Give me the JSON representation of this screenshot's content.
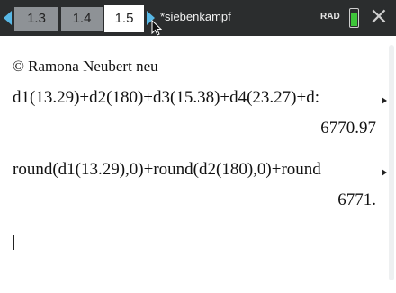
{
  "tabs": [
    {
      "label": "1.3",
      "active": false
    },
    {
      "label": "1.4",
      "active": false
    },
    {
      "label": "1.5",
      "active": true
    }
  ],
  "document_title": "*siebenkampf",
  "angle_mode": "RAD",
  "battery_level": 0.75,
  "colors": {
    "tab_bar": "#2b2d2e",
    "nav_arrow": "#58b8e6",
    "battery": "#3ec53a"
  },
  "icons": [
    "nav-left-arrow-icon",
    "nav-right-arrow-icon",
    "battery-icon",
    "close-icon",
    "mouse-pointer-icon"
  ],
  "copyright_text": "© Ramona Neubert neu",
  "history": [
    {
      "expression": "d1(13.29)+d2(180)+d3(15.38)+d4(23.27)+d:",
      "result": "6770.97"
    },
    {
      "expression": "round(d1(13.29),0)+round(d2(180),0)+round",
      "result": "6771."
    }
  ],
  "entry_line": ""
}
